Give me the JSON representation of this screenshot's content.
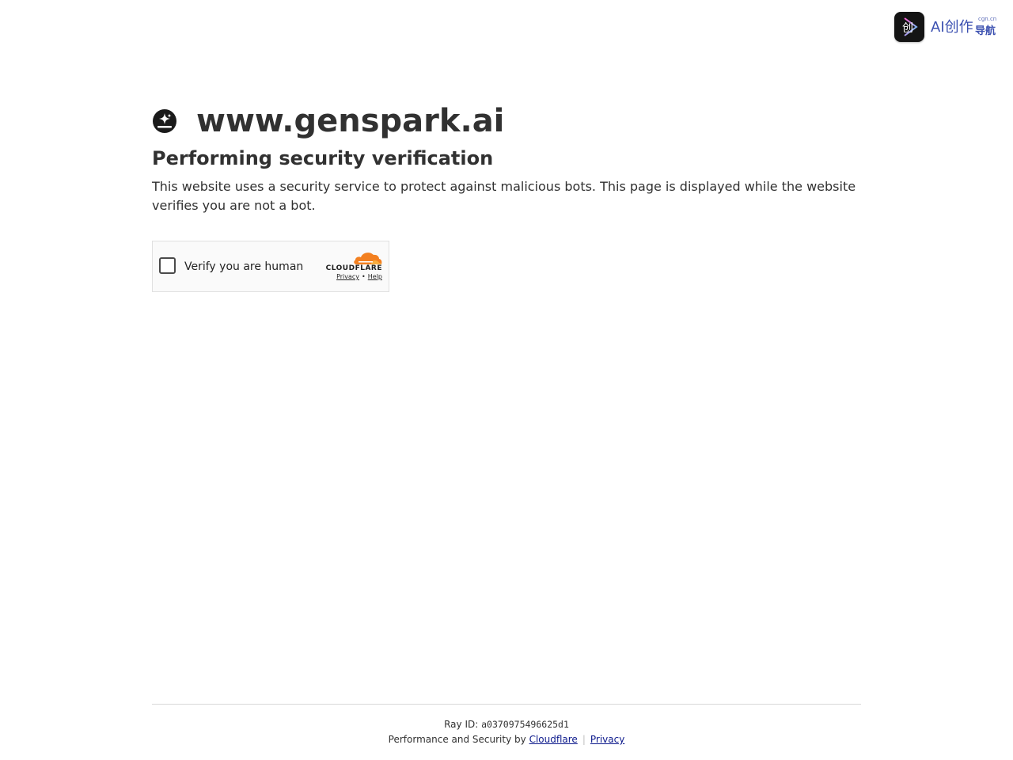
{
  "brand": {
    "name": "AI创作",
    "domain": "cgn.cn",
    "sub": "导航"
  },
  "site": {
    "name": "www.genspark.ai"
  },
  "heading": "Performing security verification",
  "description": "This website uses a security service to protect against malicious bots. This page is displayed while the website verifies you are not a bot.",
  "widget": {
    "label": "Verify you are human",
    "provider": "CLOUDFLARE",
    "privacy_label": "Privacy",
    "separator": "•",
    "help_label": "Help"
  },
  "footer": {
    "ray_label": "Ray ID:",
    "ray_id": "a0370975496625d1",
    "perf_label": "Performance and Security by",
    "cloudflare_link": "Cloudflare",
    "divider": "|",
    "privacy_link": "Privacy"
  },
  "colors": {
    "text": "#313131",
    "link": "#0d1a8c",
    "brand_blue": "#3a4fb0",
    "cloudflare_orange": "#f38020"
  }
}
